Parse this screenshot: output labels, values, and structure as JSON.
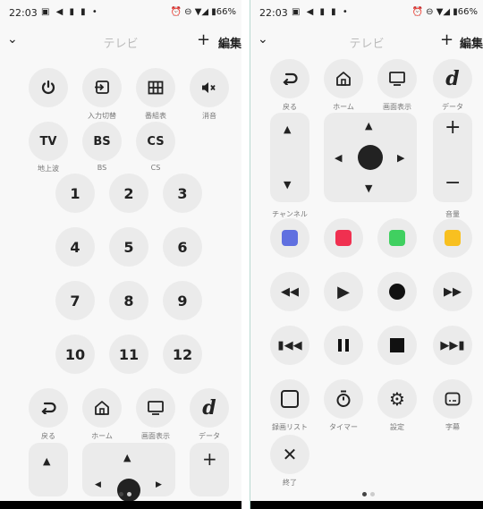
{
  "status": {
    "time": "22:03",
    "battery": "66%"
  },
  "appbar": {
    "title": "テレビ",
    "edit": "編集",
    "plus": "+"
  },
  "left": {
    "top_row_labels": [
      "",
      "入力切替",
      "番組表",
      "消音"
    ],
    "input_labels": {
      "tv": "TV",
      "bs": "BS",
      "cs": "CS"
    },
    "input_captions": [
      "地上波",
      "BS",
      "CS"
    ],
    "numbers": [
      "1",
      "2",
      "3",
      "4",
      "5",
      "6",
      "7",
      "8",
      "9",
      "10",
      "11",
      "12"
    ],
    "nav_labels": [
      "戻る",
      "ホーム",
      "画面表示",
      "データ"
    ],
    "data_glyph": "d",
    "channel_up": "▲",
    "volume_plus": "+"
  },
  "right": {
    "nav_labels": [
      "戻る",
      "ホーム",
      "画面表示",
      "データ"
    ],
    "data_glyph": "d",
    "channel_label": "チャンネル",
    "volume_label": "音量",
    "volume_plus": "+",
    "volume_minus": "−",
    "color_buttons": [
      "#6070e0",
      "#f03050",
      "#40d060",
      "#f8c020"
    ],
    "bottom_labels": [
      "録画リスト",
      "タイマー",
      "設定",
      "字幕"
    ],
    "end_label": "終了"
  }
}
